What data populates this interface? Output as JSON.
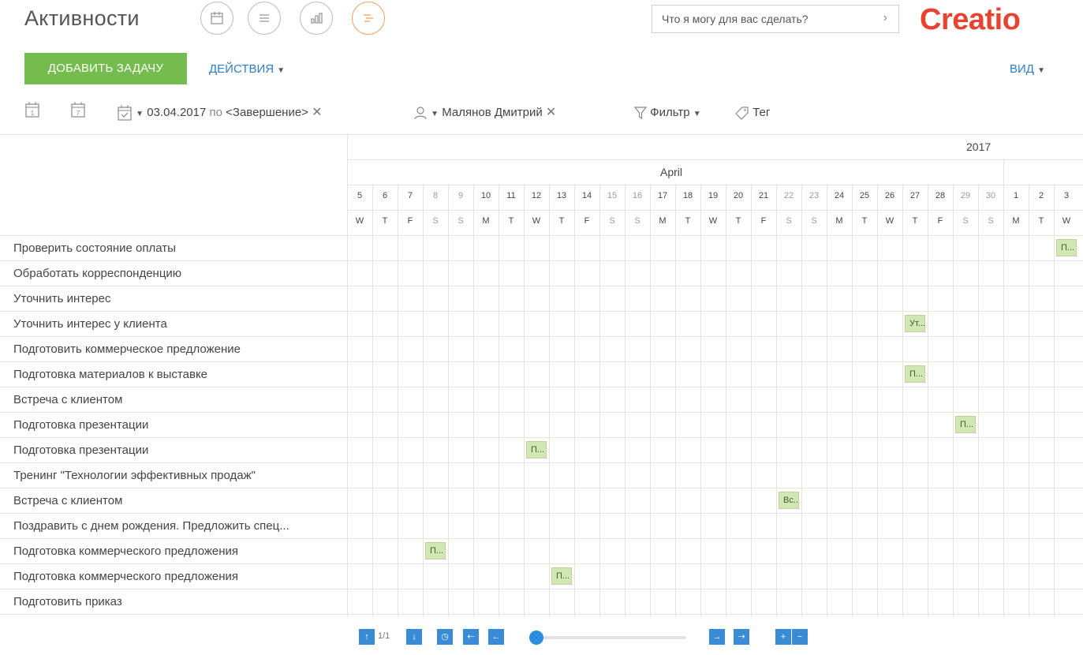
{
  "header": {
    "title": "Активности",
    "search_placeholder": "Что я могу для вас сделать?",
    "logo_text": "Creatio",
    "accent": "#f5a05f",
    "brand": "#e8432f"
  },
  "toolbar": {
    "add_label": "ДОБАВИТЬ ЗАДАЧУ",
    "actions_label": "ДЕЙСТВИЯ",
    "view_label": "ВИД",
    "add_color": "#74bc4d"
  },
  "filters": {
    "date_from": "03.04.2017",
    "date_sep": "по",
    "date_to": "<Завершение>",
    "owner": "Малянов Дмитрий",
    "filter_label": "Фильтр",
    "tag_label": "Тег",
    "day_icon_num": "1",
    "week_icon_num": "7"
  },
  "timeline": {
    "year": "2017",
    "month": "April",
    "days": [
      "5",
      "6",
      "7",
      "8",
      "9",
      "10",
      "11",
      "12",
      "13",
      "14",
      "15",
      "16",
      "17",
      "18",
      "19",
      "20",
      "21",
      "22",
      "23",
      "24",
      "25",
      "26",
      "27",
      "28",
      "29",
      "30",
      "1",
      "2",
      "3"
    ],
    "weekdays": [
      "W",
      "T",
      "F",
      "S",
      "S",
      "M",
      "T",
      "W",
      "T",
      "F",
      "S",
      "S",
      "M",
      "T",
      "W",
      "T",
      "F",
      "S",
      "S",
      "M",
      "T",
      "W",
      "T",
      "F",
      "S",
      "S",
      "M",
      "T",
      "W"
    ],
    "weekend_idx": [
      3,
      4,
      10,
      11,
      17,
      18,
      24,
      25
    ]
  },
  "tasks": [
    {
      "name": "Проверить состояние оплаты",
      "bar": "П...",
      "bar_day": 28
    },
    {
      "name": "Обработать корреспонденцию",
      "bar": "",
      "bar_day": null
    },
    {
      "name": "Уточнить интерес",
      "bar": "",
      "bar_day": null
    },
    {
      "name": "Уточнить интерес у клиента",
      "bar": "Ут...",
      "bar_day": 22
    },
    {
      "name": "Подготовить коммерческое предложение",
      "bar": "",
      "bar_day": null
    },
    {
      "name": "Подготовка материалов к выставке",
      "bar": "П...",
      "bar_day": 22
    },
    {
      "name": "Встреча с клиентом",
      "bar": "",
      "bar_day": null
    },
    {
      "name": "Подготовка презентации",
      "bar": "П...",
      "bar_day": 24
    },
    {
      "name": "Подготовка презентации",
      "bar": "П...",
      "bar_day": 7
    },
    {
      "name": "Тренинг \"Технологии эффективных продаж\"",
      "bar": "",
      "bar_day": null
    },
    {
      "name": "Встреча с клиентом",
      "bar": "Вс...",
      "bar_day": 17
    },
    {
      "name": "Поздравить с днем рождения. Предложить спец...",
      "bar": "",
      "bar_day": null
    },
    {
      "name": "Подготовка коммерческого предложения",
      "bar": "П...",
      "bar_day": 3
    },
    {
      "name": "Подготовка коммерческого предложения",
      "bar": "П...",
      "bar_day": 8
    },
    {
      "name": "Подготовить приказ",
      "bar": "",
      "bar_day": null
    }
  ],
  "pager": {
    "text": "1/1",
    "zoom_fraction": 0.0
  },
  "icons": [
    "calendar-day-icon",
    "calendar-week-icon",
    "calendar-check-icon",
    "user-icon",
    "filter-icon",
    "tag-icon",
    "list-view-icon",
    "analytics-icon",
    "gantt-icon",
    "chevron-right-icon"
  ]
}
